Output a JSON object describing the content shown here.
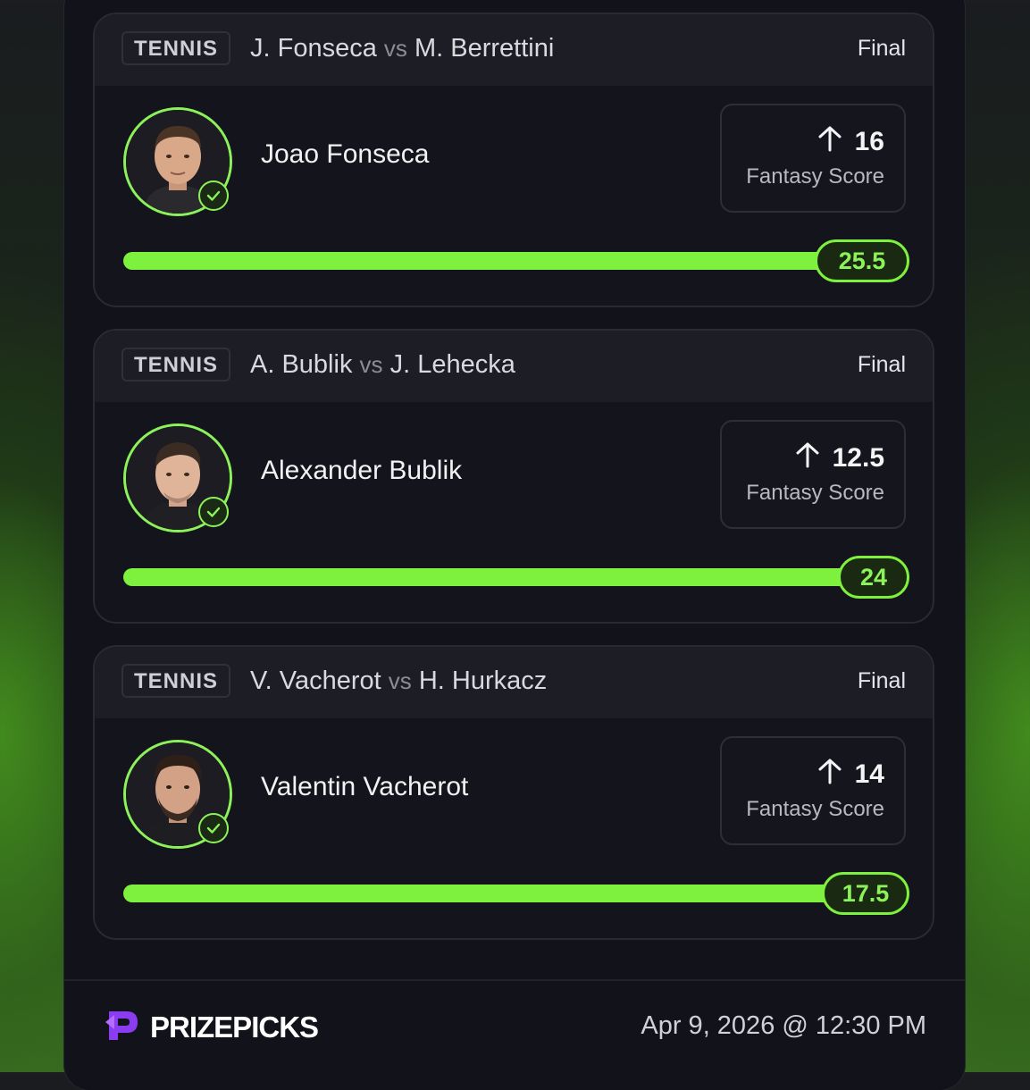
{
  "cards": [
    {
      "sport": "TENNIS",
      "player_a": "J. Fonseca",
      "vs": "vs",
      "player_b": "M. Berrettini",
      "status": "Final",
      "player_name": "Joao Fonseca",
      "projection": "16",
      "score_label": "Fantasy Score",
      "result": "25.5"
    },
    {
      "sport": "TENNIS",
      "player_a": "A. Bublik",
      "vs": "vs",
      "player_b": "J. Lehecka",
      "status": "Final",
      "player_name": "Alexander Bublik",
      "projection": "12.5",
      "score_label": "Fantasy Score",
      "result": "24"
    },
    {
      "sport": "TENNIS",
      "player_a": "V. Vacherot",
      "vs": "vs",
      "player_b": "H. Hurkacz",
      "status": "Final",
      "player_name": "Valentin Vacherot",
      "projection": "14",
      "score_label": "Fantasy Score",
      "result": "17.5"
    }
  ],
  "footer": {
    "brand": "PRIZEPICKS",
    "datetime": "Apr 9, 2026 @ 12:30 PM"
  },
  "colors": {
    "accent": "#7ef03e",
    "panel": "#12121a",
    "brand_purple": "#8a3cf0"
  },
  "icons": {
    "direction": "arrow-up-icon",
    "hit": "check-circle-icon"
  }
}
